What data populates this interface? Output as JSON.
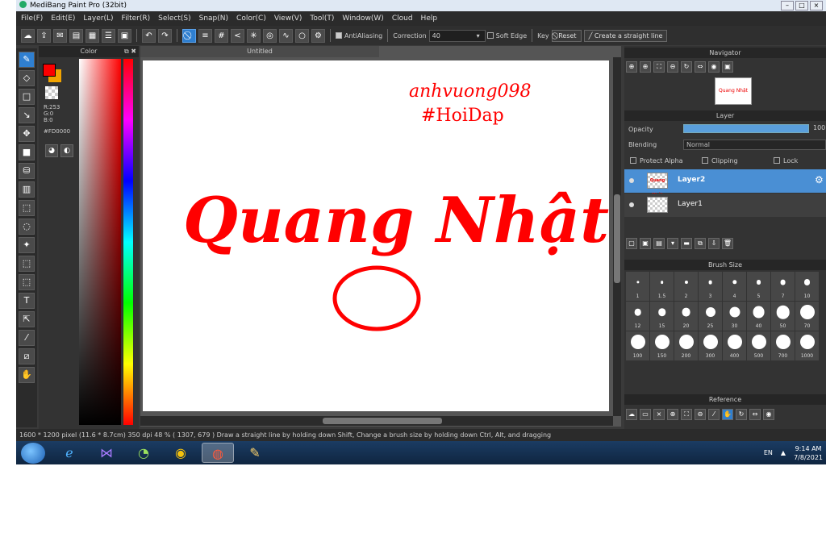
{
  "window": {
    "title": "MediBang Paint Pro (32bit)"
  },
  "menu": [
    "File(F)",
    "Edit(E)",
    "Layer(L)",
    "Filter(R)",
    "Select(S)",
    "Snap(N)",
    "Color(C)",
    "View(V)",
    "Tool(T)",
    "Window(W)",
    "Cloud",
    "Help"
  ],
  "toolbar": {
    "antialiasing_label": "AntiAliasing",
    "correction_label": "Correction",
    "correction_value": "40",
    "soft_edge_label": "Soft Edge",
    "key_label": "Key",
    "reset_label": "Reset",
    "straight_line_label": "Create a straight line"
  },
  "color_panel": {
    "title": "Color",
    "r": "R:253",
    "g": "G:0",
    "b": "B:0",
    "hex": "#FD0000",
    "fg_color": "#fd0000"
  },
  "canvas": {
    "tab_title": "Untitled",
    "drawn_text_main": "Quang Nhật",
    "drawn_text_corner_1": "anhvuong098",
    "drawn_text_corner_2": "#HoiDap",
    "ink_color": "#ff0000"
  },
  "navigator": {
    "title": "Navigator",
    "thumb_text": "Quang Nhật"
  },
  "layer_panel": {
    "title": "Layer",
    "opacity_label": "Opacity",
    "opacity_value": "100",
    "opacity_fraction": 1.0,
    "blending_label": "Blending",
    "blending_value": "Normal",
    "protect_alpha": "Protect Alpha",
    "clipping": "Clipping",
    "lock": "Lock",
    "layers": [
      {
        "name": "Layer2",
        "selected": true,
        "thumb": "Quang Nhật"
      },
      {
        "name": "Layer1",
        "selected": false,
        "thumb": ""
      }
    ]
  },
  "brush_size": {
    "title": "Brush Size",
    "sizes": [
      "1",
      "1.5",
      "2",
      "3",
      "4",
      "5",
      "7",
      "10",
      "12",
      "15",
      "20",
      "25",
      "30",
      "40",
      "50",
      "70",
      "100",
      "150",
      "200",
      "300",
      "400",
      "500",
      "700",
      "1000"
    ]
  },
  "reference": {
    "title": "Reference"
  },
  "status": {
    "text": "1600 * 1200 pixel  (11.6 * 8.7cm)  350 dpi  48 %  ( 1307, 679 )  Draw a straight line by holding down Shift, Change a brush size by holding down Ctrl, Alt, and dragging"
  },
  "taskbar": {
    "lang": "EN",
    "time": "9:14 AM",
    "date": "7/8/2021"
  }
}
